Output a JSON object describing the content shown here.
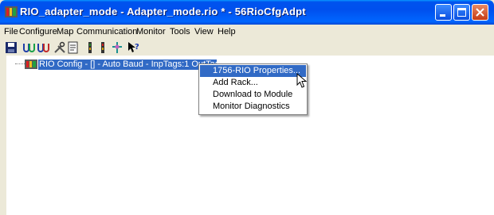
{
  "window": {
    "title": "RIO_adapter_mode - Adapter_mode.rio * - 56RioCfgAdpt",
    "controls": [
      "minimize",
      "maximize",
      "close"
    ]
  },
  "menubar": {
    "items": [
      "File",
      "Configure",
      "Map",
      "Communication",
      "Monitor",
      "Tools",
      "View",
      "Help"
    ]
  },
  "toolbar": {
    "icons": [
      "save-icon",
      "connect-icon",
      "disconnect-icon",
      "tools-icon",
      "properties-icon",
      "upload-icon",
      "download-icon",
      "rack-icon",
      "whats-this-help-icon"
    ]
  },
  "tree": {
    "root_label": "RIO Config - [] - Auto Baud - InpTags:1 OutTags:1"
  },
  "context_menu": {
    "items": [
      "1756-RIO Properties...",
      "Add Rack...",
      "Download to Module",
      "Monitor Diagnostics"
    ],
    "selected_index": 0
  },
  "colors": {
    "title_bar": "#0053ee",
    "selection": "#316ac5",
    "close_button": "#c63b16"
  }
}
